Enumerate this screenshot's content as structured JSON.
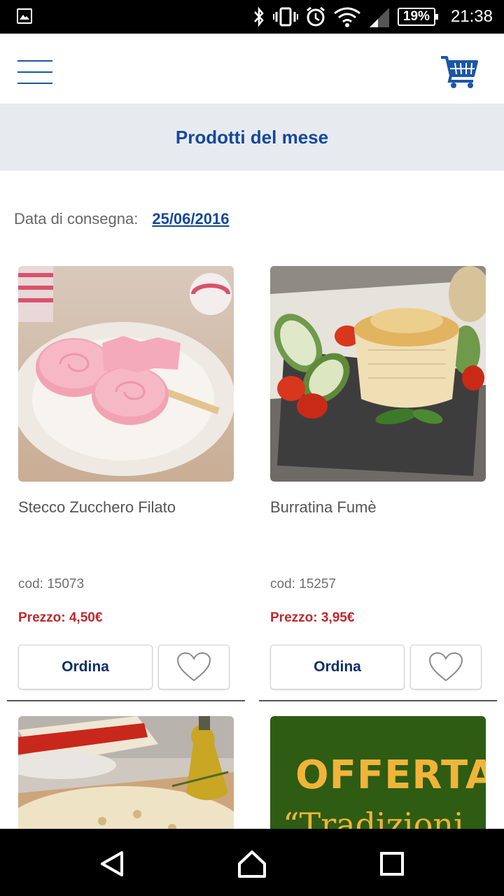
{
  "status_bar": {
    "battery": "19%",
    "time": "21:38"
  },
  "header": {
    "menu_icon": "hamburger-icon",
    "cart_icon": "cart-icon"
  },
  "page": {
    "title": "Prodotti del mese"
  },
  "delivery": {
    "label": "Data di consegna:",
    "date": "25/06/2016"
  },
  "products": [
    {
      "name": "Stecco Zucchero Filato",
      "code": "cod: 15073",
      "price": "Prezzo: 4,50€",
      "order_label": "Ordina",
      "favorite_icon": "heart-outline-icon"
    },
    {
      "name": "Burratina Fumè",
      "code": "cod: 15257",
      "price": "Prezzo: 3,95€",
      "order_label": "Ordina",
      "favorite_icon": "heart-outline-icon"
    }
  ],
  "next_row": {
    "offer_title": "OFFERTA",
    "offer_subtitle": "“Tradizioni"
  },
  "colors": {
    "brand_blue": "#15489b",
    "price_red": "#c0282d",
    "title_bg": "#e7ebf0",
    "offer_green": "#2e5c12",
    "offer_yellow": "#f0b43a"
  },
  "nav_bar": {
    "back_icon": "back-triangle-icon",
    "home_icon": "home-icon",
    "recents_icon": "recents-square-icon"
  }
}
